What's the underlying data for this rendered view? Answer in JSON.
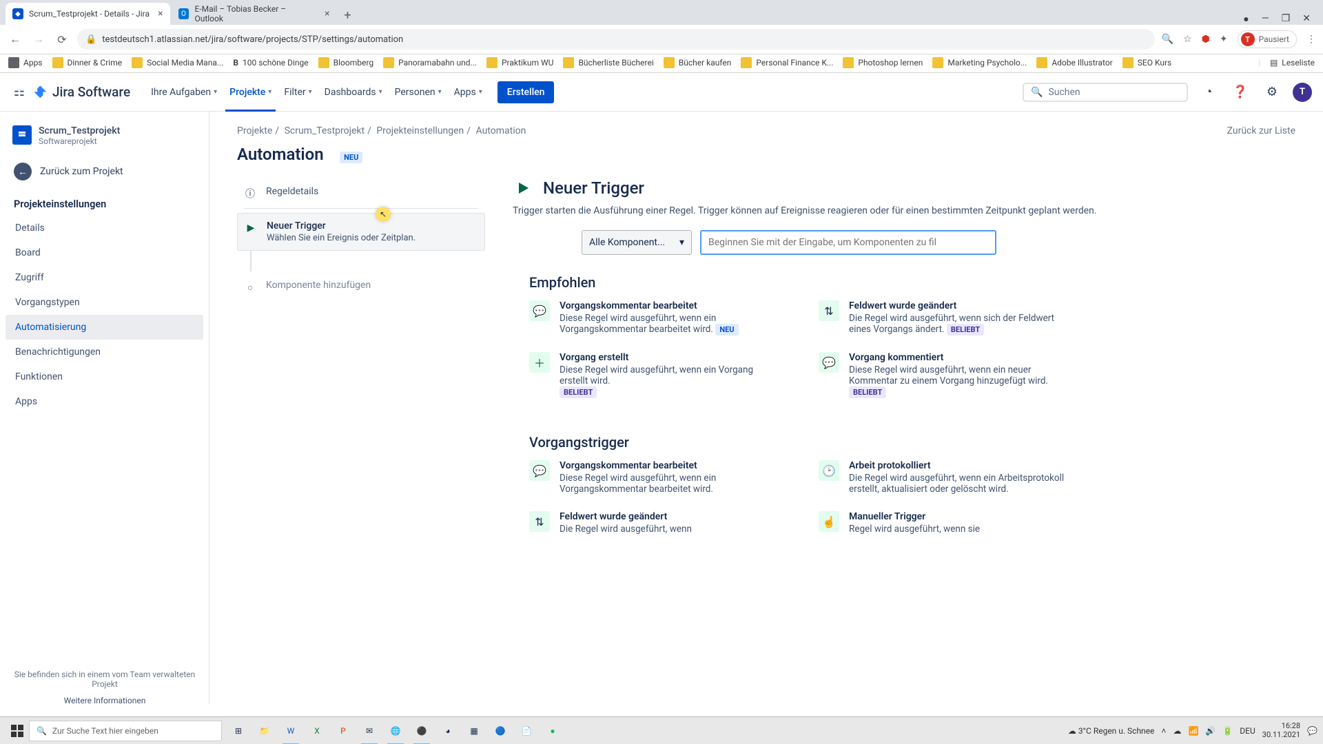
{
  "browser": {
    "tabs": [
      {
        "title": "Scrum_Testprojekt - Details - Jira",
        "active": true
      },
      {
        "title": "E-Mail – Tobias Becker – Outlook",
        "active": false
      }
    ],
    "url": "testdeutsch1.atlassian.net/jira/software/projects/STP/settings/automation",
    "profile_status": "Pausiert",
    "profile_initial": "T",
    "bookmarks": [
      "Apps",
      "Dinner & Crime",
      "Social Media Mana...",
      "100 schöne Dinge",
      "Bloomberg",
      "Panoramabahn und...",
      "Praktikum WU",
      "Bücherliste Bücherei",
      "Bücher kaufen",
      "Personal Finance K...",
      "Photoshop lernen",
      "Marketing Psycholo...",
      "Adobe Illustrator",
      "SEO Kurs"
    ],
    "reading_list": "Leseliste"
  },
  "jira_nav": {
    "product": "Jira Software",
    "items": [
      "Ihre Aufgaben",
      "Projekte",
      "Filter",
      "Dashboards",
      "Personen",
      "Apps"
    ],
    "active_index": 1,
    "create": "Erstellen",
    "search_placeholder": "Suchen",
    "avatar_initial": "T"
  },
  "sidebar": {
    "project_title": "Scrum_Testprojekt",
    "project_subtitle": "Softwareprojekt",
    "back_to_project": "Zurück zum Projekt",
    "section": "Projekteinstellungen",
    "items": [
      "Details",
      "Board",
      "Zugriff",
      "Vorgangstypen",
      "Automatisierung",
      "Benachrichtigungen",
      "Funktionen",
      "Apps"
    ],
    "active_index": 4,
    "footer_text": "Sie befinden sich in einem vom Team verwalteten Projekt",
    "footer_link": "Weitere Informationen"
  },
  "crumbs": [
    "Projekte",
    "Scrum_Testprojekt",
    "Projekteinstellungen",
    "Automation"
  ],
  "page": {
    "title": "Automation",
    "badge": "NEU",
    "back_link": "Zurück zur Liste"
  },
  "rule": {
    "rule_details": "Regeldetails",
    "trigger_title": "Neuer Trigger",
    "trigger_sub": "Wählen Sie ein Ereignis oder Zeitplan.",
    "add_component": "Komponente hinzufügen"
  },
  "panel": {
    "heading": "Neuer Trigger",
    "description": "Trigger starten die Ausführung einer Regel. Trigger können auf Ereignisse reagieren oder für einen bestimmten Zeitpunkt geplant werden.",
    "dropdown_label": "Alle Komponent...",
    "filter_placeholder": "Beginnen Sie mit der Eingabe, um Komponenten zu fil"
  },
  "groups": {
    "recommended_heading": "Empfohlen",
    "issue_heading": "Vorgangstrigger",
    "badge_new": "NEU",
    "badge_popular": "BELIEBT",
    "recommended": [
      {
        "title": "Vorgangskommentar bearbeitet",
        "desc": "Diese Regel wird ausgeführt, wenn ein Vorgangskommentar bearbeitet wird.",
        "new": true
      },
      {
        "title": "Feldwert wurde geändert",
        "desc": "Die Regel wird ausgeführt, wenn sich der Feldwert eines Vorgangs ändert.",
        "popular": true
      },
      {
        "title": "Vorgang erstellt",
        "desc": "Diese Regel wird ausgeführt, wenn ein Vorgang erstellt wird.",
        "popular": true
      },
      {
        "title": "Vorgang kommentiert",
        "desc": "Diese Regel wird ausgeführt, wenn ein neuer Kommentar zu einem Vorgang hinzugefügt wird.",
        "popular": true
      }
    ],
    "issue_triggers": [
      {
        "title": "Vorgangskommentar bearbeitet",
        "desc": "Diese Regel wird ausgeführt, wenn ein Vorgangskommentar bearbeitet wird."
      },
      {
        "title": "Arbeit protokolliert",
        "desc": "Die Regel wird ausgeführt, wenn ein Arbeitsprotokoll erstellt, aktualisiert oder gelöscht wird."
      },
      {
        "title": "Feldwert wurde geändert",
        "desc": "Die Regel wird ausgeführt, wenn"
      },
      {
        "title": "Manueller Trigger",
        "desc": "Regel wird ausgeführt, wenn sie"
      }
    ]
  },
  "taskbar": {
    "search_placeholder": "Zur Suche Text hier eingeben",
    "weather": "3°C  Regen u. Schnee",
    "lang": "DEU",
    "time": "16:28",
    "date": "30.11.2021"
  }
}
